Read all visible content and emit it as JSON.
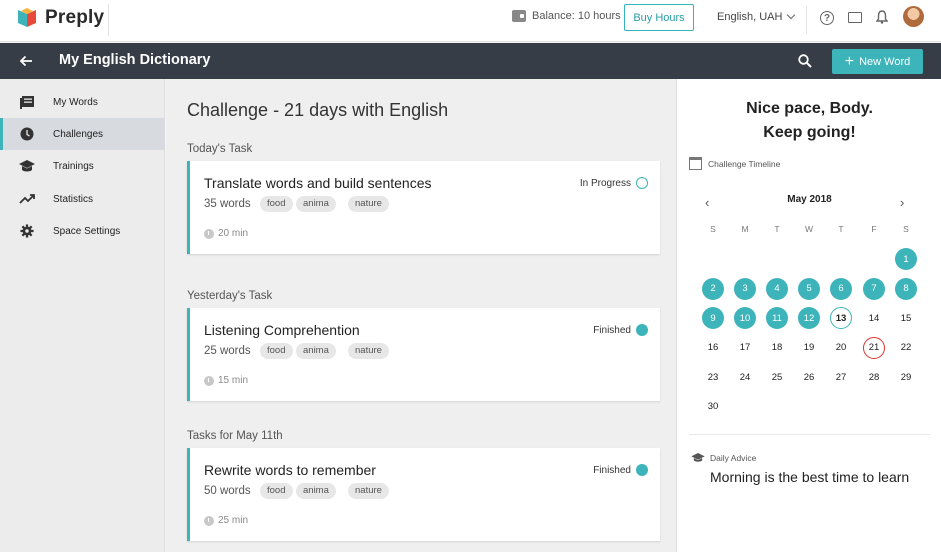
{
  "topbar": {
    "brand": "Preply",
    "balance": "Balance: 10 hours",
    "buy_label": "Buy Hours",
    "language": "English, UAH",
    "help_glyph": "?",
    "icons": [
      "wallet-icon",
      "help-icon",
      "chat-icon",
      "bell-icon",
      "avatar"
    ]
  },
  "header": {
    "title": "My English Dictionary",
    "new_word_label": "New Word",
    "new_word_plus": "+"
  },
  "sidebar": {
    "items": [
      {
        "label": "My Words",
        "icon": "book-icon",
        "active": false
      },
      {
        "label": "Challenges",
        "icon": "clock-icon",
        "active": true
      },
      {
        "label": "Trainings",
        "icon": "graduation-cap-icon",
        "active": false
      },
      {
        "label": "Statistics",
        "icon": "trend-icon",
        "active": false
      },
      {
        "label": "Space Settings",
        "icon": "gear-icon",
        "active": false
      }
    ]
  },
  "main": {
    "title": "Challenge - 21 days with English",
    "sections": [
      {
        "label": "Today's Task",
        "task": {
          "title": "Translate words and build sentences",
          "count": "35 words",
          "tags": [
            "food",
            "anima",
            "nature"
          ],
          "time": "20 min",
          "status": "In Progress",
          "status_state": "hollow"
        }
      },
      {
        "label": "Yesterday's Task",
        "task": {
          "title": "Listening Comprehention",
          "count": "25 words",
          "tags": [
            "food",
            "anima",
            "nature"
          ],
          "time": "15 min",
          "status": "Finished",
          "status_state": "filled"
        }
      },
      {
        "label": "Tasks for May 11th",
        "task": {
          "title": "Rewrite words to remember",
          "count": "50 words",
          "tags": [
            "food",
            "anima",
            "nature"
          ],
          "time": "25 min",
          "status": "Finished",
          "status_state": "filled"
        }
      }
    ]
  },
  "rightpanel": {
    "pace_line1": "Nice pace, Body.",
    "pace_line2": "Keep going!",
    "timeline_label": "Challenge Timeline",
    "month": "May 2018",
    "prev": "‹",
    "next": "›",
    "weekdays": [
      "S",
      "M",
      "T",
      "W",
      "T",
      "F",
      "S"
    ],
    "first_weekday_index": 6,
    "days_in_month": 30,
    "done_days": [
      1,
      2,
      3,
      4,
      5,
      6,
      7,
      8,
      9,
      10,
      11,
      12
    ],
    "today_day": 13,
    "target_day": 21,
    "advice_label": "Daily Advice",
    "advice_text": "Morning is the best time to learn"
  },
  "colors": {
    "accent": "#3cb4b9",
    "header_bg": "#373d47",
    "target_red": "#d9342b"
  }
}
